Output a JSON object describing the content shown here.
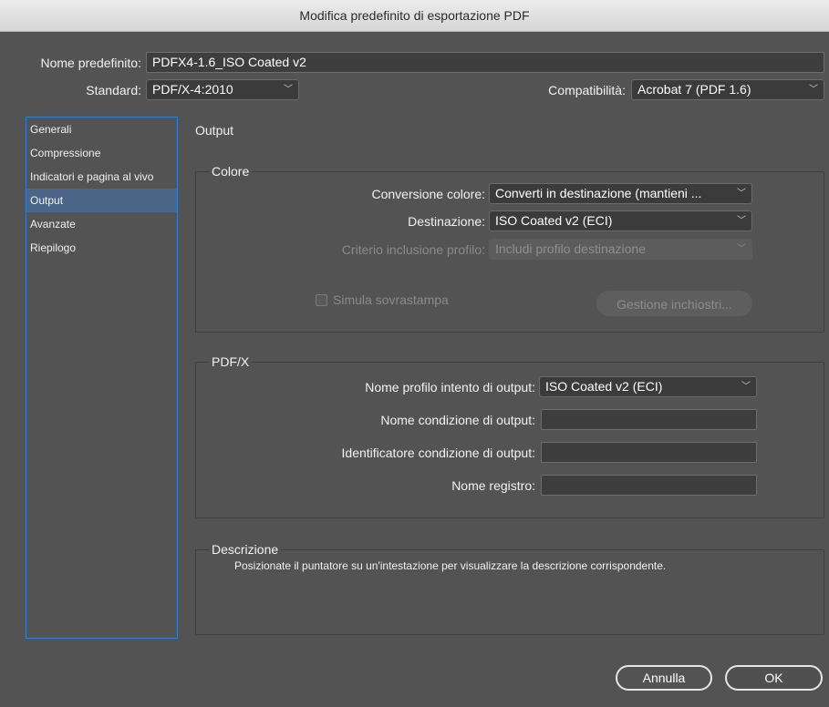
{
  "window": {
    "title": "Modifica predefinito di esportazione PDF"
  },
  "preset": {
    "label": "Nome predefinito:",
    "value": "PDFX4-1.6_ISO Coated v2"
  },
  "standard": {
    "label": "Standard:",
    "value": "PDF/X-4:2010"
  },
  "compatibility": {
    "label": "Compatibilità:",
    "value": "Acrobat 7 (PDF 1.6)"
  },
  "sidebar": {
    "items": [
      {
        "label": "Generali"
      },
      {
        "label": "Compressione"
      },
      {
        "label": "Indicatori e pagina al vivo"
      },
      {
        "label": "Output"
      },
      {
        "label": "Avanzate"
      },
      {
        "label": "Riepilogo"
      }
    ],
    "selected": "Output"
  },
  "panel": {
    "title": "Output"
  },
  "colore": {
    "title": "Colore",
    "conversione": {
      "label": "Conversione colore:",
      "value": "Converti in destinazione (mantieni ..."
    },
    "destinazione": {
      "label": "Destinazione:",
      "value": "ISO Coated v2 (ECI)"
    },
    "criterio": {
      "label": "Criterio inclusione profilo:",
      "value": "Includi profilo destinazione"
    },
    "simula": {
      "label": "Simula sovrastampa"
    },
    "gestione": {
      "label": "Gestione inchiostri..."
    }
  },
  "pdfx": {
    "title": "PDF/X",
    "profilo": {
      "label": "Nome profilo intento di output:",
      "value": "ISO Coated v2 (ECI)"
    },
    "condizione": {
      "label": "Nome condizione di output:",
      "value": ""
    },
    "identificatore": {
      "label": "Identificatore condizione di output:",
      "value": ""
    },
    "registro": {
      "label": "Nome registro:",
      "value": ""
    }
  },
  "descrizione": {
    "title": "Descrizione",
    "text": "Posizionate il puntatore su un'intestazione per visualizzare la descrizione corrispondente."
  },
  "buttons": {
    "cancel": "Annulla",
    "ok": "OK"
  }
}
